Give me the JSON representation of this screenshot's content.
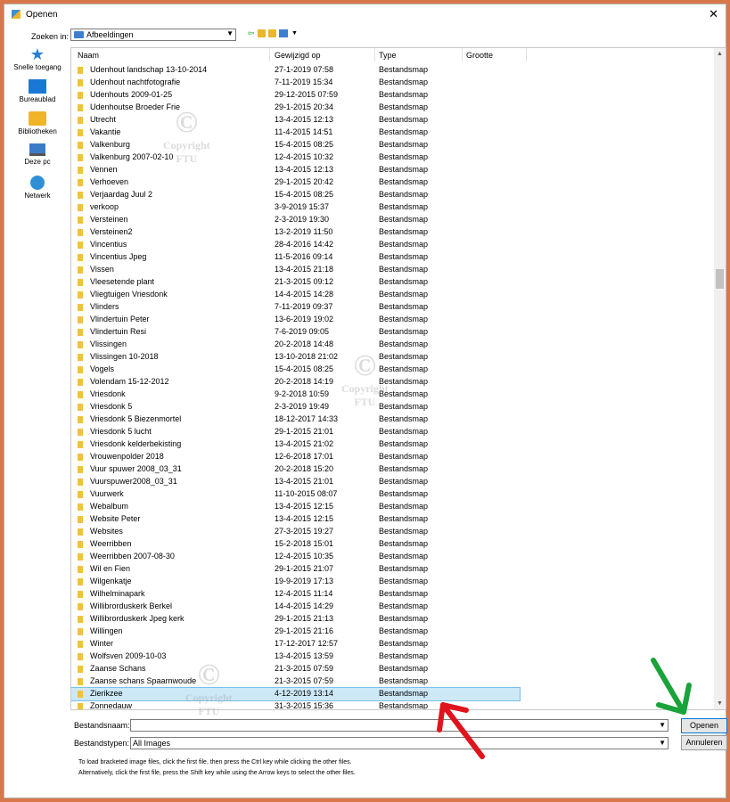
{
  "window": {
    "title": "Openen",
    "close_glyph": "✕"
  },
  "lookin": {
    "label": "Zoeken in:",
    "value": "Afbeeldingen"
  },
  "places": [
    {
      "label": "Snelle toegang",
      "icon": "star-icon"
    },
    {
      "label": "Bureaublad",
      "icon": "desktop-icon"
    },
    {
      "label": "Bibliotheken",
      "icon": "libraries-icon"
    },
    {
      "label": "Deze pc",
      "icon": "computer-icon"
    },
    {
      "label": "Netwerk",
      "icon": "network-icon"
    }
  ],
  "columns": [
    "Naam",
    "Gewijzigd op",
    "Type",
    "Grootte"
  ],
  "files": [
    [
      "Udenhout landschap 13-10-2014",
      "27-1-2019 07:58",
      "Bestandsmap"
    ],
    [
      "Udenhout nachtfotografie",
      "7-11-2019 15:34",
      "Bestandsmap"
    ],
    [
      "Udenhouts 2009-01-25",
      "29-12-2015 07:59",
      "Bestandsmap"
    ],
    [
      "Udenhoutse Broeder Frie",
      "29-1-2015 20:34",
      "Bestandsmap"
    ],
    [
      "Utrecht",
      "13-4-2015 12:13",
      "Bestandsmap"
    ],
    [
      "Vakantie",
      "11-4-2015 14:51",
      "Bestandsmap"
    ],
    [
      "Valkenburg",
      "15-4-2015 08:25",
      "Bestandsmap"
    ],
    [
      "Valkenburg 2007-02-10",
      "12-4-2015 10:32",
      "Bestandsmap"
    ],
    [
      "Vennen",
      "13-4-2015 12:13",
      "Bestandsmap"
    ],
    [
      "Verhoeven",
      "29-1-2015 20:42",
      "Bestandsmap"
    ],
    [
      "Verjaardag Juul 2",
      "15-4-2015 08:25",
      "Bestandsmap"
    ],
    [
      "verkoop",
      "3-9-2019 15:37",
      "Bestandsmap"
    ],
    [
      "Versteinen",
      "2-3-2019 19:30",
      "Bestandsmap"
    ],
    [
      "Versteinen2",
      "13-2-2019 11:50",
      "Bestandsmap"
    ],
    [
      "Vincentius",
      "28-4-2016 14:42",
      "Bestandsmap"
    ],
    [
      "Vincentius Jpeg",
      "11-5-2016 09:14",
      "Bestandsmap"
    ],
    [
      "Vissen",
      "13-4-2015 21:18",
      "Bestandsmap"
    ],
    [
      "Vleesetende plant",
      "21-3-2015 09:12",
      "Bestandsmap"
    ],
    [
      "Vliegtuigen Vriesdonk",
      "14-4-2015 14:28",
      "Bestandsmap"
    ],
    [
      "Vlinders",
      "7-11-2019 09:37",
      "Bestandsmap"
    ],
    [
      "Vlindertuin Peter",
      "13-6-2019 19:02",
      "Bestandsmap"
    ],
    [
      "Vlindertuin Resi",
      "7-6-2019 09:05",
      "Bestandsmap"
    ],
    [
      "Vlissingen",
      "20-2-2018 14:48",
      "Bestandsmap"
    ],
    [
      "Vlissingen 10-2018",
      "13-10-2018 21:02",
      "Bestandsmap"
    ],
    [
      "Vogels",
      "15-4-2015 08:25",
      "Bestandsmap"
    ],
    [
      "Volendam 15-12-2012",
      "20-2-2018 14:19",
      "Bestandsmap"
    ],
    [
      "Vriesdonk",
      "9-2-2018 10:59",
      "Bestandsmap"
    ],
    [
      "Vriesdonk 5",
      "2-3-2019 19:49",
      "Bestandsmap"
    ],
    [
      "Vriesdonk 5 Biezenmortel",
      "18-12-2017 14:33",
      "Bestandsmap"
    ],
    [
      "Vriesdonk 5 lucht",
      "29-1-2015 21:01",
      "Bestandsmap"
    ],
    [
      "Vriesdonk kelderbekisting",
      "13-4-2015 21:02",
      "Bestandsmap"
    ],
    [
      "Vrouwenpolder 2018",
      "12-6-2018 17:01",
      "Bestandsmap"
    ],
    [
      "Vuur spuwer 2008_03_31",
      "20-2-2018 15:20",
      "Bestandsmap"
    ],
    [
      "Vuurspuwer2008_03_31",
      "13-4-2015 21:01",
      "Bestandsmap"
    ],
    [
      "Vuurwerk",
      "11-10-2015 08:07",
      "Bestandsmap"
    ],
    [
      "Webalbum",
      "13-4-2015 12:15",
      "Bestandsmap"
    ],
    [
      "Website Peter",
      "13-4-2015 12:15",
      "Bestandsmap"
    ],
    [
      "Websites",
      "27-3-2015 19:27",
      "Bestandsmap"
    ],
    [
      "Weerribben",
      "15-2-2018 15:01",
      "Bestandsmap"
    ],
    [
      "Weerribben 2007-08-30",
      "12-4-2015 10:35",
      "Bestandsmap"
    ],
    [
      "Wil en Fien",
      "29-1-2015 21:07",
      "Bestandsmap"
    ],
    [
      "Wilgenkatje",
      "19-9-2019 17:13",
      "Bestandsmap"
    ],
    [
      "Wilhelminapark",
      "12-4-2015 11:14",
      "Bestandsmap"
    ],
    [
      "Willibrorduskerk Berkel",
      "14-4-2015 14:29",
      "Bestandsmap"
    ],
    [
      "Willibrorduskerk Jpeg kerk",
      "29-1-2015 21:13",
      "Bestandsmap"
    ],
    [
      "Willingen",
      "29-1-2015 21:16",
      "Bestandsmap"
    ],
    [
      "Winter",
      "17-12-2017 12:57",
      "Bestandsmap"
    ],
    [
      "Wolfsven 2009-10-03",
      "13-4-2015 13:59",
      "Bestandsmap"
    ],
    [
      "Zaanse Schans",
      "21-3-2015 07:59",
      "Bestandsmap"
    ],
    [
      "Zaanse schans  Spaarnwoude",
      "21-3-2015 07:59",
      "Bestandsmap"
    ],
    [
      "Zierikzee",
      "4-12-2019 13:14",
      "Bestandsmap"
    ],
    [
      "Zonnedauw",
      "31-3-2015 15:36",
      "Bestandsmap"
    ]
  ],
  "selected_index": 50,
  "filename": {
    "label": "Bestandsnaam:",
    "value": ""
  },
  "filetype": {
    "label": "Bestandstypen:",
    "value": "All Images"
  },
  "buttons": {
    "open": "Openen",
    "cancel": "Annuleren"
  },
  "hints": [
    "To load bracketed image files, click the first file, then press the Ctrl key while clicking the other files.",
    "Alternatively, click the first file, press the Shift key while using the Arrow keys to select the other files."
  ],
  "watermark": {
    "symbol": "©",
    "text": "Copyright",
    "initials": "FTU"
  },
  "colors": {
    "frame": "#d9774a",
    "selection": "#cde8f7",
    "arrow_green": "#1aa33a",
    "arrow_red": "#e0141c"
  }
}
